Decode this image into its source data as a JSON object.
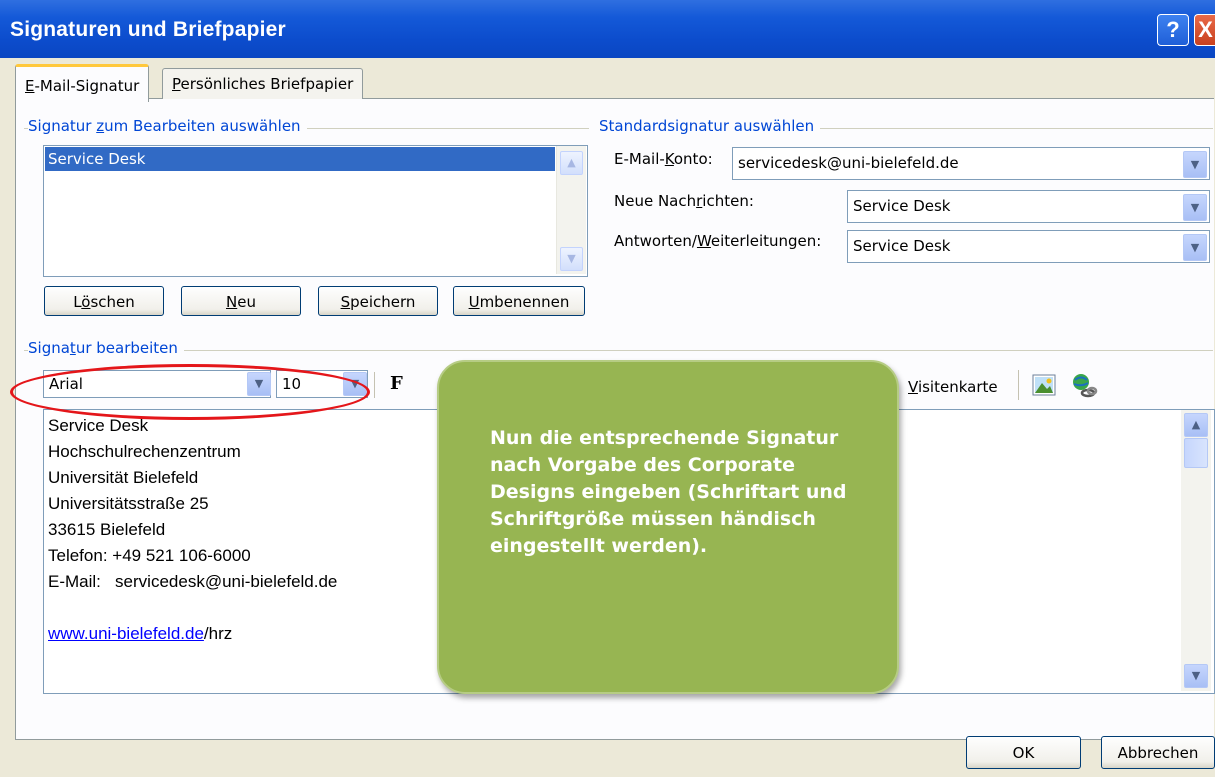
{
  "window": {
    "title": "Signaturen und Briefpapier",
    "help_glyph": "?",
    "close_glyph": "X"
  },
  "tabs": {
    "email_sig_prefix": "E",
    "email_sig_rest": "-Mail-Signatur",
    "stationery_prefix": "P",
    "stationery_rest": "ersönliches Briefpapier"
  },
  "select_group": {
    "label_pre": "Signatur ",
    "label_u": "z",
    "label_post": "um Bearbeiten auswählen"
  },
  "signatures": [
    "Service Desk"
  ],
  "buttons": {
    "delete_pre": "L",
    "delete_u": "ö",
    "delete_post": "schen",
    "new_u": "N",
    "new_post": "eu",
    "save_u": "S",
    "save_post": "peichern",
    "rename_u": "U",
    "rename_post": "mbenennen",
    "ok": "OK",
    "cancel": "Abbrechen"
  },
  "default_group": {
    "label": "Standardsignatur auswählen"
  },
  "account": {
    "label_pre": "E-Mail-",
    "label_u": "K",
    "label_post": "onto:",
    "value": "servicedesk@uni-bielefeld.de"
  },
  "new_messages": {
    "label_pre": "Neue Nach",
    "label_u": "r",
    "label_post": "ichten:",
    "value": "Service Desk"
  },
  "replies": {
    "label_pre": "Antworten/",
    "label_u": "W",
    "label_post": "eiterleitungen:",
    "value": "Service Desk"
  },
  "edit_group": {
    "label_pre": "Signa",
    "label_u": "t",
    "label_post": "ur bearbeiten"
  },
  "toolbar": {
    "font": "Arial",
    "size": "10",
    "bold_glyph": "F",
    "business_card_u": "V",
    "business_card_post": "isitenkarte"
  },
  "signature_text": {
    "line1": "Service Desk",
    "line2": "Hochschulrechenzentrum",
    "line3": "Universität Bielefeld",
    "line4": "Universitätsstraße 25",
    "line5": "33615 Bielefeld",
    "line6": "Telefon: +49 521 106-6000",
    "line7": "E-Mail:   servicedesk@uni-bielefeld.de",
    "link": "www.uni-bielefeld.de",
    "link_suffix": "/hrz"
  },
  "callout": {
    "text": "Nun die entsprechende Signatur nach Vorgabe des Corporate Designs eingeben (Schriftart und Schriftgröße müssen händisch eingestellt werden)."
  },
  "colors": {
    "titlebar": "#0c4ccc",
    "group_label": "#0046d5",
    "selection": "#316ac5",
    "callout": "#97b552",
    "highlight_ring": "#e4161a",
    "link": "#0000ff"
  },
  "icons": {
    "help": "help-icon",
    "close": "close-icon",
    "dropdown": "chevron-down-icon",
    "picture": "insert-picture-icon",
    "hyperlink": "hyperlink-icon"
  }
}
